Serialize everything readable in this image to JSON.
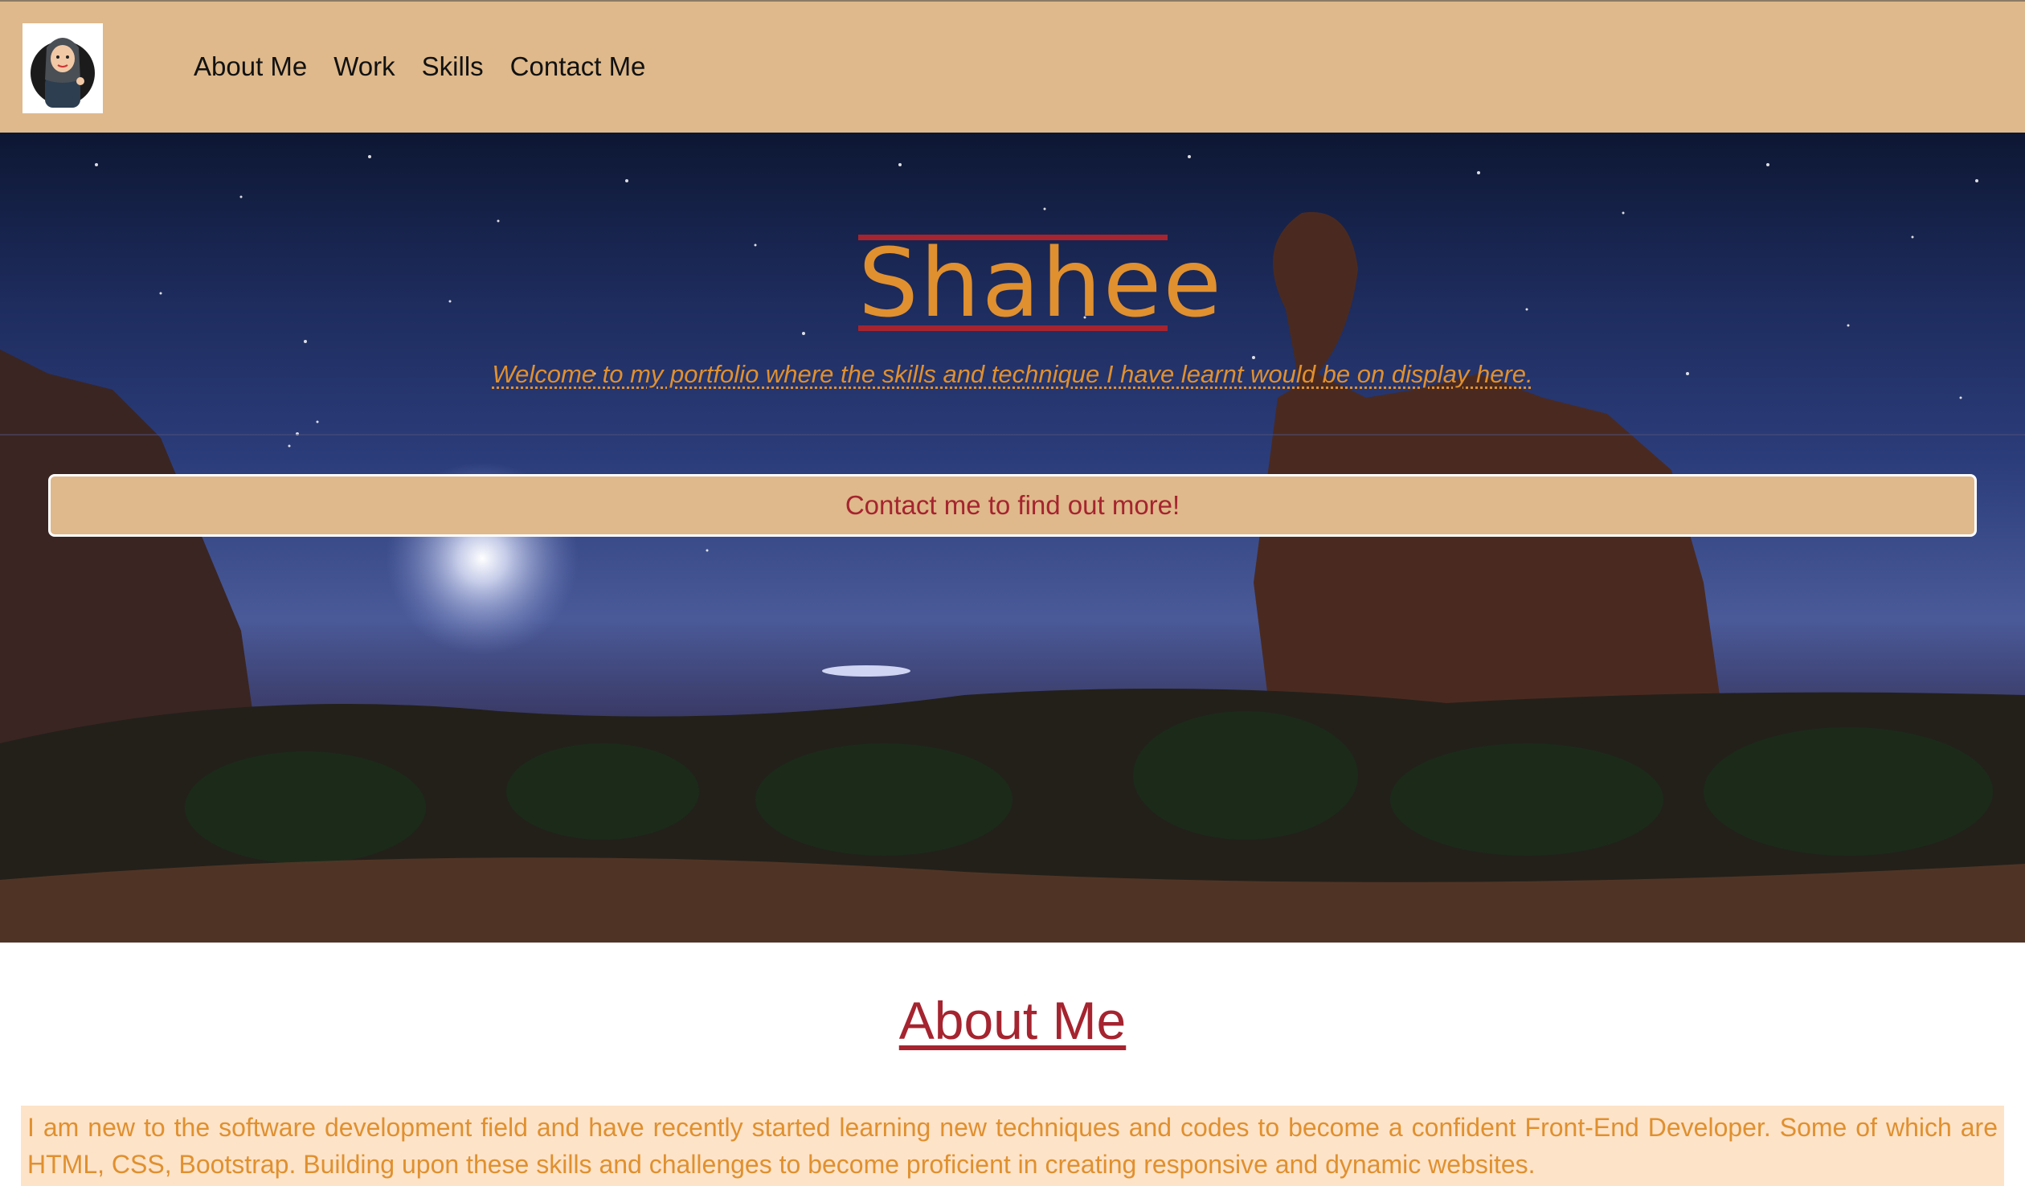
{
  "nav": {
    "avatar_alt": "profile avatar",
    "links": [
      "About Me",
      "Work",
      "Skills",
      "Contact Me"
    ]
  },
  "hero": {
    "title": "Shahee",
    "subtitle": "Welcome to my portfolio where the skills and technique I have learnt would be on display here.",
    "cta_label": "Contact me to find out more!"
  },
  "about": {
    "heading": "About Me",
    "text": "I am new to the software development field and have recently started learning new techniques and codes to become a confident Front-End Developer. Some of which are HTML, CSS, Bootstrap. Building upon these skills and challenges to become proficient in creating responsive and dynamic websites."
  },
  "colors": {
    "nav_bg": "#dfb98b",
    "accent_red": "#a5242f",
    "accent_orange": "#e0902f",
    "about_bg": "#fde3c8"
  }
}
